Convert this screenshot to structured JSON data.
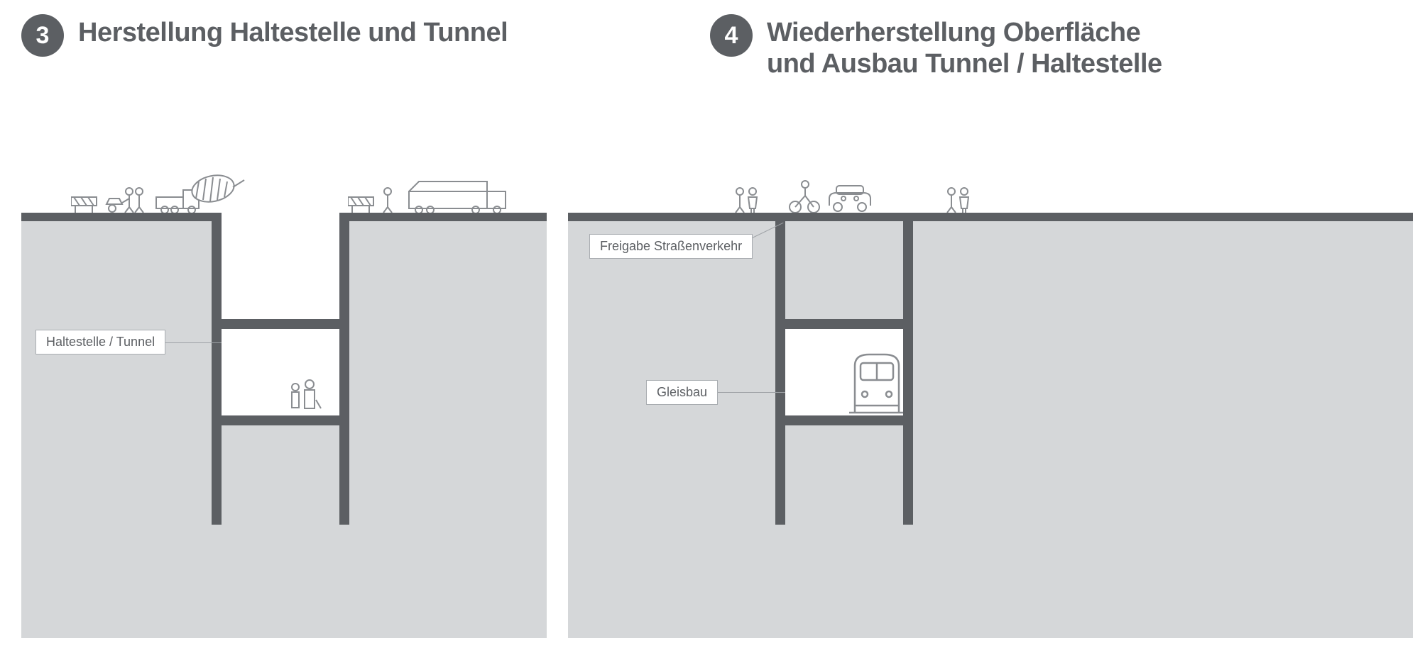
{
  "panels": {
    "left": {
      "number": "3",
      "title": "Herstellung Haltestelle und Tunnel",
      "label_tunnel": "Haltestelle / Tunnel"
    },
    "right": {
      "number": "4",
      "title": "Wiederherstellung Oberfläche\nund Ausbau Tunnel / Haltestelle",
      "label_traffic": "Freigabe Straßenverkehr",
      "label_track": "Gleisbau"
    }
  },
  "colors": {
    "dark": "#5c5f63",
    "light": "#d5d7d9",
    "line": "#9ea2a6"
  }
}
